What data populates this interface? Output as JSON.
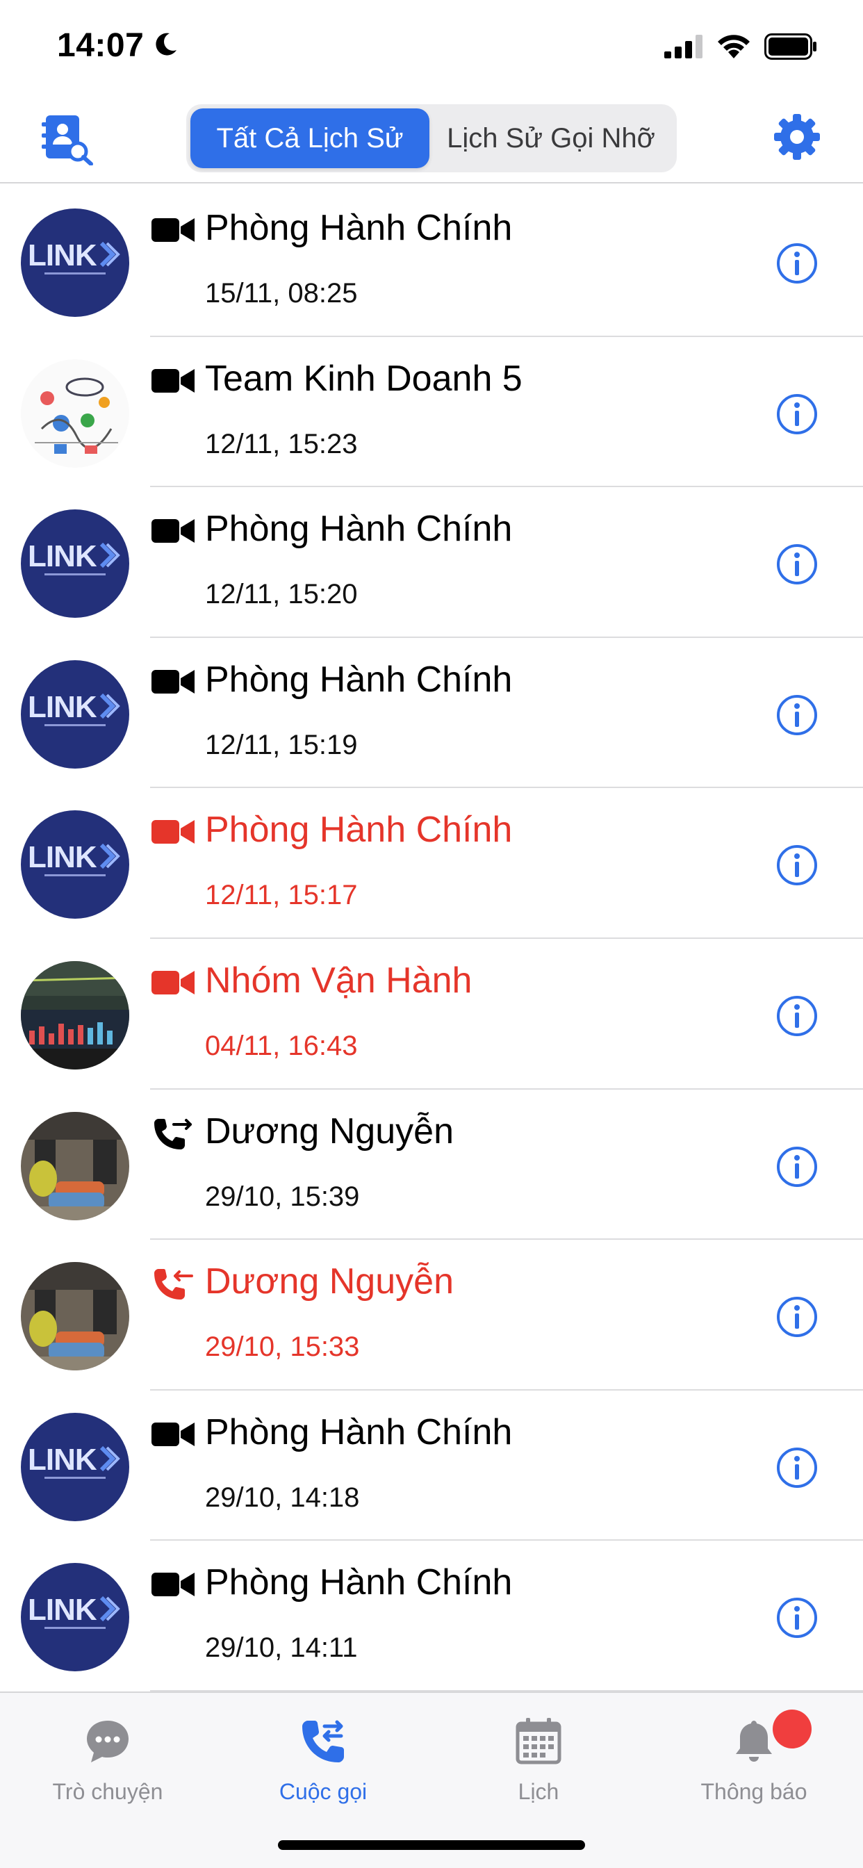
{
  "status_bar": {
    "time": "14:07"
  },
  "header": {
    "segments": [
      "Tất Cả Lịch Sử",
      "Lịch Sử Gọi Nhỡ"
    ],
    "selected_segment": "Tất Cả Lịch Sử",
    "accent_color": "#2f6fe8"
  },
  "calls": [
    {
      "name": "Phòng Hành Chính",
      "time": "15/11, 08:25",
      "type": "video-icon",
      "missed": false,
      "avatar": "link-logo"
    },
    {
      "name": "Team Kinh Doanh 5",
      "time": "12/11, 15:23",
      "type": "video-icon",
      "missed": false,
      "avatar": "business-sketch"
    },
    {
      "name": "Phòng Hành Chính",
      "time": "12/11, 15:20",
      "type": "video-icon",
      "missed": false,
      "avatar": "link-logo"
    },
    {
      "name": "Phòng Hành Chính",
      "time": "12/11, 15:19",
      "type": "video-icon",
      "missed": false,
      "avatar": "link-logo"
    },
    {
      "name": "Phòng Hành Chính",
      "time": "12/11, 15:17",
      "type": "video-icon",
      "missed": true,
      "avatar": "link-logo"
    },
    {
      "name": "Nhóm Vận Hành",
      "time": "04/11, 16:43",
      "type": "video-icon",
      "missed": true,
      "avatar": "chart-photo"
    },
    {
      "name": "Dương Nguyễn",
      "time": "29/10, 15:39",
      "type": "outgoing-call-icon",
      "missed": false,
      "avatar": "office-photo"
    },
    {
      "name": "Dương Nguyễn",
      "time": "29/10, 15:33",
      "type": "incoming-call-icon",
      "missed": true,
      "avatar": "office-photo"
    },
    {
      "name": "Phòng Hành Chính",
      "time": "29/10, 14:18",
      "type": "video-icon",
      "missed": false,
      "avatar": "link-logo"
    },
    {
      "name": "Phòng Hành Chính",
      "time": "29/10, 14:11",
      "type": "video-icon",
      "missed": false,
      "avatar": "link-logo"
    }
  ],
  "missed_color": "#e5352a",
  "tab_bar": {
    "tabs": [
      {
        "label": "Trò chuyện",
        "icon": "chat-bubble-icon",
        "active": false
      },
      {
        "label": "Cuộc gọi",
        "icon": "phone-transfer-icon",
        "active": true
      },
      {
        "label": "Lịch",
        "icon": "calendar-icon",
        "active": false
      },
      {
        "label": "Thông báo",
        "icon": "bell-icon",
        "active": false,
        "badge": true
      }
    ]
  }
}
